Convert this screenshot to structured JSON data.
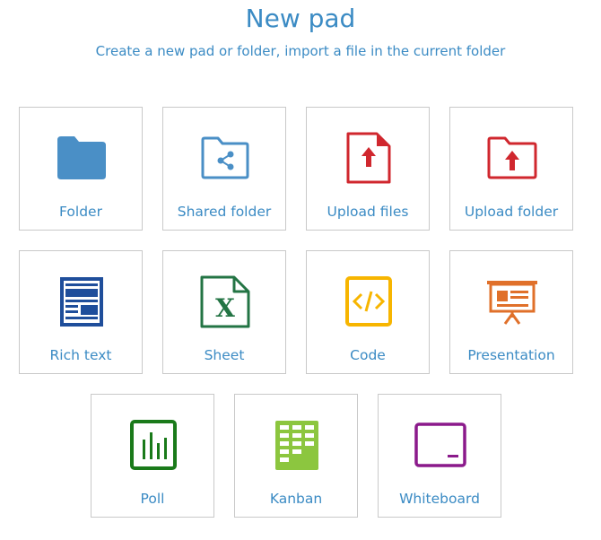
{
  "header": {
    "title": "New pad",
    "subtitle": "Create a new pad or folder, import a file in the current folder"
  },
  "tiles": [
    {
      "label": "Folder",
      "icon": "folder-icon",
      "color": "#4a8fc6"
    },
    {
      "label": "Shared folder",
      "icon": "shared-folder-icon",
      "color": "#4a8fc6"
    },
    {
      "label": "Upload files",
      "icon": "upload-file-icon",
      "color": "#d0272e"
    },
    {
      "label": "Upload folder",
      "icon": "upload-folder-icon",
      "color": "#d0272e"
    },
    {
      "label": "Rich text",
      "icon": "rich-text-icon",
      "color": "#1f4e9b"
    },
    {
      "label": "Sheet",
      "icon": "sheet-icon",
      "color": "#237444"
    },
    {
      "label": "Code",
      "icon": "code-icon",
      "color": "#f7b500"
    },
    {
      "label": "Presentation",
      "icon": "presentation-icon",
      "color": "#e0702a"
    },
    {
      "label": "Poll",
      "icon": "poll-icon",
      "color": "#1a7a1a"
    },
    {
      "label": "Kanban",
      "icon": "kanban-icon",
      "color": "#8cc63f"
    },
    {
      "label": "Whiteboard",
      "icon": "whiteboard-icon",
      "color": "#8b1a8b"
    }
  ]
}
